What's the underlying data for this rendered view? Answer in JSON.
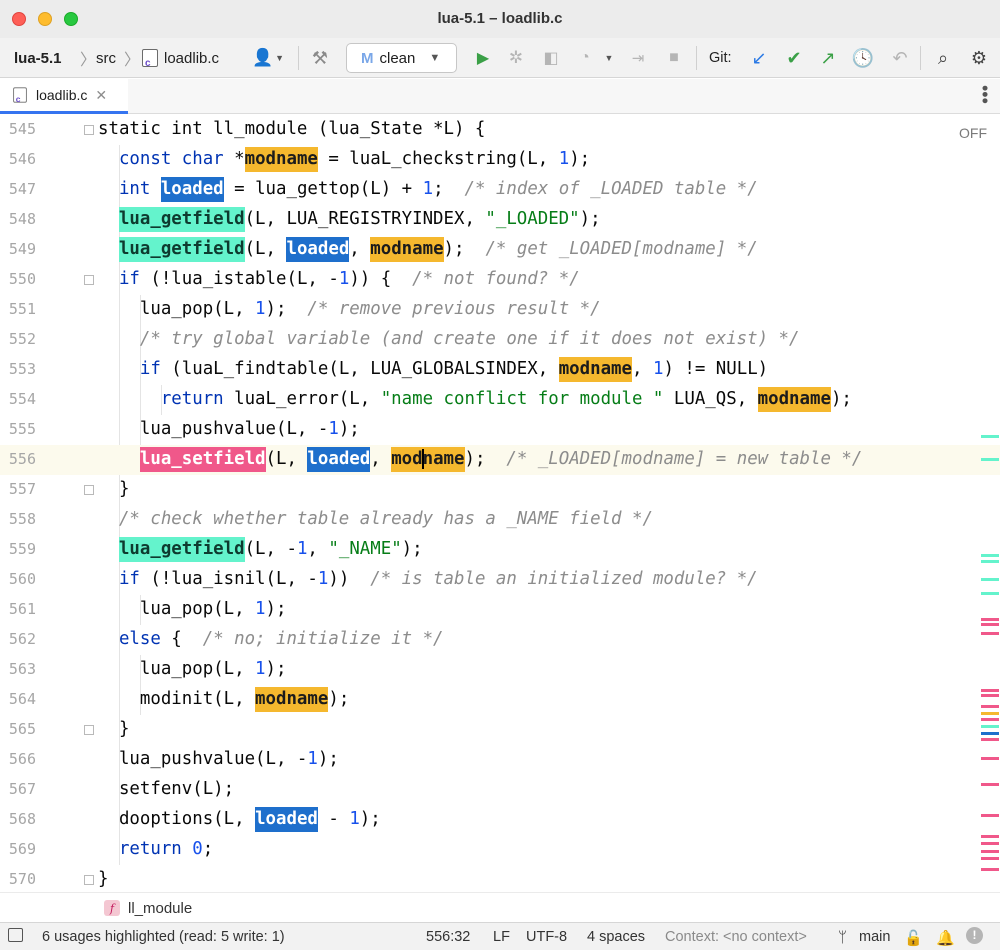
{
  "window": {
    "title": "lua-5.1 – loadlib.c"
  },
  "toolbar": {
    "project": "lua-5.1",
    "folder": "src",
    "file": "loadlib.c",
    "run_config": "clean",
    "git_label": "Git:"
  },
  "tabs": [
    {
      "label": "loadlib.c",
      "active": true
    }
  ],
  "editor": {
    "inspection_label": "OFF",
    "caret_line": 556,
    "lines": [
      {
        "n": "545",
        "parts": [
          [
            "t",
            "static int ll_module (lua_State *L) {"
          ]
        ]
      },
      {
        "n": "546",
        "parts": [
          [
            "k",
            "const char "
          ],
          [
            "t",
            "*"
          ],
          [
            "y",
            "modname"
          ],
          [
            "t",
            " = luaL_checkstring(L, "
          ],
          [
            "n",
            "1"
          ],
          [
            "t",
            ");"
          ]
        ]
      },
      {
        "n": "547",
        "parts": [
          [
            "k",
            "int "
          ],
          [
            "b",
            "loaded"
          ],
          [
            "t",
            " = lua_gettop(L) + "
          ],
          [
            "n",
            "1"
          ],
          [
            "t",
            ";  "
          ],
          [
            "c",
            "/* index of _LOADED table */"
          ]
        ]
      },
      {
        "n": "548",
        "parts": [
          [
            "g",
            "lua_getfield"
          ],
          [
            "t",
            "(L, LUA_REGISTRYINDEX, "
          ],
          [
            "s",
            "\"_LOADED\""
          ],
          [
            "t",
            ");"
          ]
        ]
      },
      {
        "n": "549",
        "parts": [
          [
            "g",
            "lua_getfield"
          ],
          [
            "t",
            "(L, "
          ],
          [
            "b",
            "loaded"
          ],
          [
            "t",
            ", "
          ],
          [
            "y",
            "modname"
          ],
          [
            "t",
            ");  "
          ],
          [
            "c",
            "/* get _LOADED[modname] */"
          ]
        ]
      },
      {
        "n": "550",
        "parts": [
          [
            "k",
            "if"
          ],
          [
            "t",
            " (!lua_istable(L, -"
          ],
          [
            "n",
            "1"
          ],
          [
            "t",
            ")) {  "
          ],
          [
            "c",
            "/* not found? */"
          ]
        ]
      },
      {
        "n": "551",
        "parts": [
          [
            "t",
            "lua_pop(L, "
          ],
          [
            "n",
            "1"
          ],
          [
            "t",
            ");  "
          ],
          [
            "c",
            "/* remove previous result */"
          ]
        ]
      },
      {
        "n": "552",
        "parts": [
          [
            "c",
            "/* try global variable (and create one if it does not exist) */"
          ]
        ]
      },
      {
        "n": "553",
        "parts": [
          [
            "k",
            "if"
          ],
          [
            "t",
            " (luaL_findtable(L, LUA_GLOBALSINDEX, "
          ],
          [
            "y",
            "modname"
          ],
          [
            "t",
            ", "
          ],
          [
            "n",
            "1"
          ],
          [
            "t",
            ") != NULL)"
          ]
        ]
      },
      {
        "n": "554",
        "parts": [
          [
            "k",
            "return "
          ],
          [
            "t",
            "luaL_error(L, "
          ],
          [
            "s",
            "\"name conflict for module \""
          ],
          [
            "t",
            " LUA_QS, "
          ],
          [
            "y",
            "modname"
          ],
          [
            "t",
            ");"
          ]
        ]
      },
      {
        "n": "555",
        "parts": [
          [
            "t",
            "lua_pushvalue(L, -"
          ],
          [
            "n",
            "1"
          ],
          [
            "t",
            ");"
          ]
        ]
      },
      {
        "n": "556",
        "parts": [
          [
            "p",
            "lua_setfield"
          ],
          [
            "t",
            "(L, "
          ],
          [
            "b",
            "loaded"
          ],
          [
            "t",
            ", "
          ],
          [
            "yc",
            "modname"
          ],
          [
            "t",
            ");  "
          ],
          [
            "c",
            "/* _LOADED[modname] = new table */"
          ]
        ]
      },
      {
        "n": "557",
        "parts": [
          [
            "t",
            "}"
          ]
        ]
      },
      {
        "n": "558",
        "parts": [
          [
            "c",
            "/* check whether table already has a _NAME field */"
          ]
        ]
      },
      {
        "n": "559",
        "parts": [
          [
            "g",
            "lua_getfield"
          ],
          [
            "t",
            "(L, -"
          ],
          [
            "n",
            "1"
          ],
          [
            "t",
            ", "
          ],
          [
            "s",
            "\"_NAME\""
          ],
          [
            "t",
            ");"
          ]
        ]
      },
      {
        "n": "560",
        "parts": [
          [
            "k",
            "if"
          ],
          [
            "t",
            " (!lua_isnil(L, -"
          ],
          [
            "n",
            "1"
          ],
          [
            "t",
            "))  "
          ],
          [
            "c",
            "/* is table an initialized module? */"
          ]
        ]
      },
      {
        "n": "561",
        "parts": [
          [
            "t",
            "lua_pop(L, "
          ],
          [
            "n",
            "1"
          ],
          [
            "t",
            ");"
          ]
        ]
      },
      {
        "n": "562",
        "parts": [
          [
            "k",
            "else"
          ],
          [
            "t",
            " {  "
          ],
          [
            "c",
            "/* no; initialize it */"
          ]
        ]
      },
      {
        "n": "563",
        "parts": [
          [
            "t",
            "lua_pop(L, "
          ],
          [
            "n",
            "1"
          ],
          [
            "t",
            ");"
          ]
        ]
      },
      {
        "n": "564",
        "parts": [
          [
            "t",
            "modinit(L, "
          ],
          [
            "y",
            "modname"
          ],
          [
            "t",
            ");"
          ]
        ]
      },
      {
        "n": "565",
        "parts": [
          [
            "t",
            "}"
          ]
        ]
      },
      {
        "n": "566",
        "parts": [
          [
            "t",
            "lua_pushvalue(L, -"
          ],
          [
            "n",
            "1"
          ],
          [
            "t",
            ");"
          ]
        ]
      },
      {
        "n": "567",
        "parts": [
          [
            "t",
            "setfenv(L);"
          ]
        ]
      },
      {
        "n": "568",
        "parts": [
          [
            "t",
            "dooptions(L, "
          ],
          [
            "b",
            "loaded"
          ],
          [
            "t",
            " - "
          ],
          [
            "n",
            "1"
          ],
          [
            "t",
            ");"
          ]
        ]
      },
      {
        "n": "569",
        "parts": [
          [
            "k",
            "return "
          ],
          [
            "n",
            "0"
          ],
          [
            "t",
            ";"
          ]
        ]
      },
      {
        "n": "570",
        "parts": [
          [
            "t",
            "}"
          ]
        ]
      }
    ]
  },
  "breadcrumb": {
    "badge": "f",
    "function": "ll_module"
  },
  "status": {
    "usages": "6 usages highlighted (read: 5 write: 1)",
    "position": "556:32",
    "line_sep": "LF",
    "encoding": "UTF-8",
    "indent": "4 spaces",
    "context": "Context: <no context>",
    "branch": "main"
  },
  "colors": {
    "highlight_read": "#f5b82e",
    "highlight_var": "#1e6fcc",
    "highlight_call": "#64f3cc",
    "highlight_write": "#f0588a",
    "keyword": "#0033b3",
    "string": "#067d17",
    "comment": "#8c8c8c",
    "run": "#3ba047",
    "git_update": "#2d7be5",
    "git_commit": "#3ba047"
  }
}
